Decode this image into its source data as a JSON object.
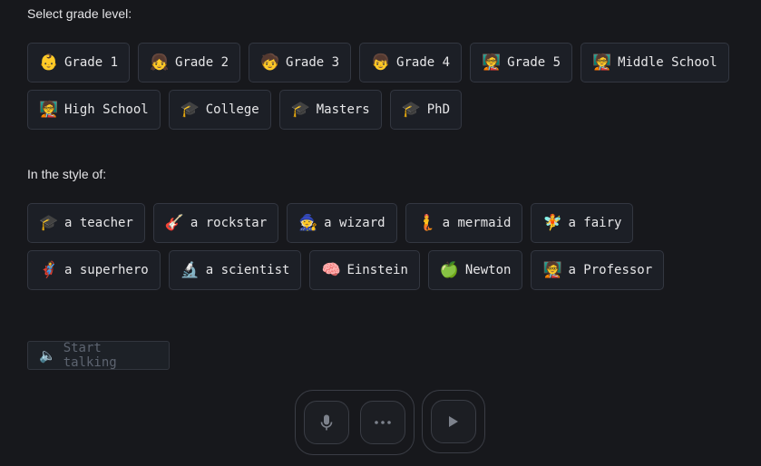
{
  "grade_section": {
    "label": "Select grade level:",
    "row1": [
      {
        "icon": "👶",
        "icon_name": "baby-icon",
        "label": "Grade 1"
      },
      {
        "icon": "👧",
        "icon_name": "girl-icon",
        "label": "Grade 2"
      },
      {
        "icon": "🧒",
        "icon_name": "child-icon",
        "label": "Grade 3"
      },
      {
        "icon": "👦",
        "icon_name": "boy-icon",
        "label": "Grade 4"
      },
      {
        "icon": "🧑‍🏫",
        "icon_name": "teacher-icon",
        "label": "Grade 5"
      },
      {
        "icon": "🧑‍🏫",
        "icon_name": "teacher-icon",
        "label": "Middle School"
      }
    ],
    "row2": [
      {
        "icon": "🧑‍🏫",
        "icon_name": "teacher-icon",
        "label": "High School"
      },
      {
        "icon": "🎓",
        "icon_name": "graduation-cap-icon",
        "label": "College"
      },
      {
        "icon": "🎓",
        "icon_name": "graduation-cap-icon",
        "label": "Masters"
      },
      {
        "icon": "🎓",
        "icon_name": "graduation-cap-icon",
        "label": "PhD"
      }
    ]
  },
  "style_section": {
    "label": "In the style of:",
    "row1": [
      {
        "icon": "🎓",
        "icon_name": "graduation-cap-icon",
        "label": "a teacher"
      },
      {
        "icon": "🎸",
        "icon_name": "guitar-icon",
        "label": "a rockstar"
      },
      {
        "icon": "🧙",
        "icon_name": "wizard-icon",
        "label": "a wizard"
      },
      {
        "icon": "🧜",
        "icon_name": "mermaid-icon",
        "label": "a mermaid"
      },
      {
        "icon": "🧚",
        "icon_name": "fairy-icon",
        "label": "a fairy"
      }
    ],
    "row2": [
      {
        "icon": "🦸",
        "icon_name": "superhero-icon",
        "label": "a superhero"
      },
      {
        "icon": "🔬",
        "icon_name": "microscope-icon",
        "label": "a scientist"
      },
      {
        "icon": "🧠",
        "icon_name": "brain-icon",
        "label": "Einstein"
      },
      {
        "icon": "🍏",
        "icon_name": "green-apple-icon",
        "label": "Newton"
      },
      {
        "icon": "🧑‍🏫",
        "icon_name": "teacher-icon",
        "label": "a Professor"
      }
    ]
  },
  "start": {
    "icon": "🔈",
    "icon_name": "speaker-icon",
    "label": "Start talking"
  },
  "controls": {
    "mic_icon": "microphone-icon",
    "more_icon": "more-icon",
    "play_icon": "play-icon"
  },
  "colors": {
    "background": "#17181c",
    "chip_bg": "#1c1f26",
    "chip_border": "#333741",
    "text": "#e6e6e8",
    "muted": "#5d6470"
  }
}
